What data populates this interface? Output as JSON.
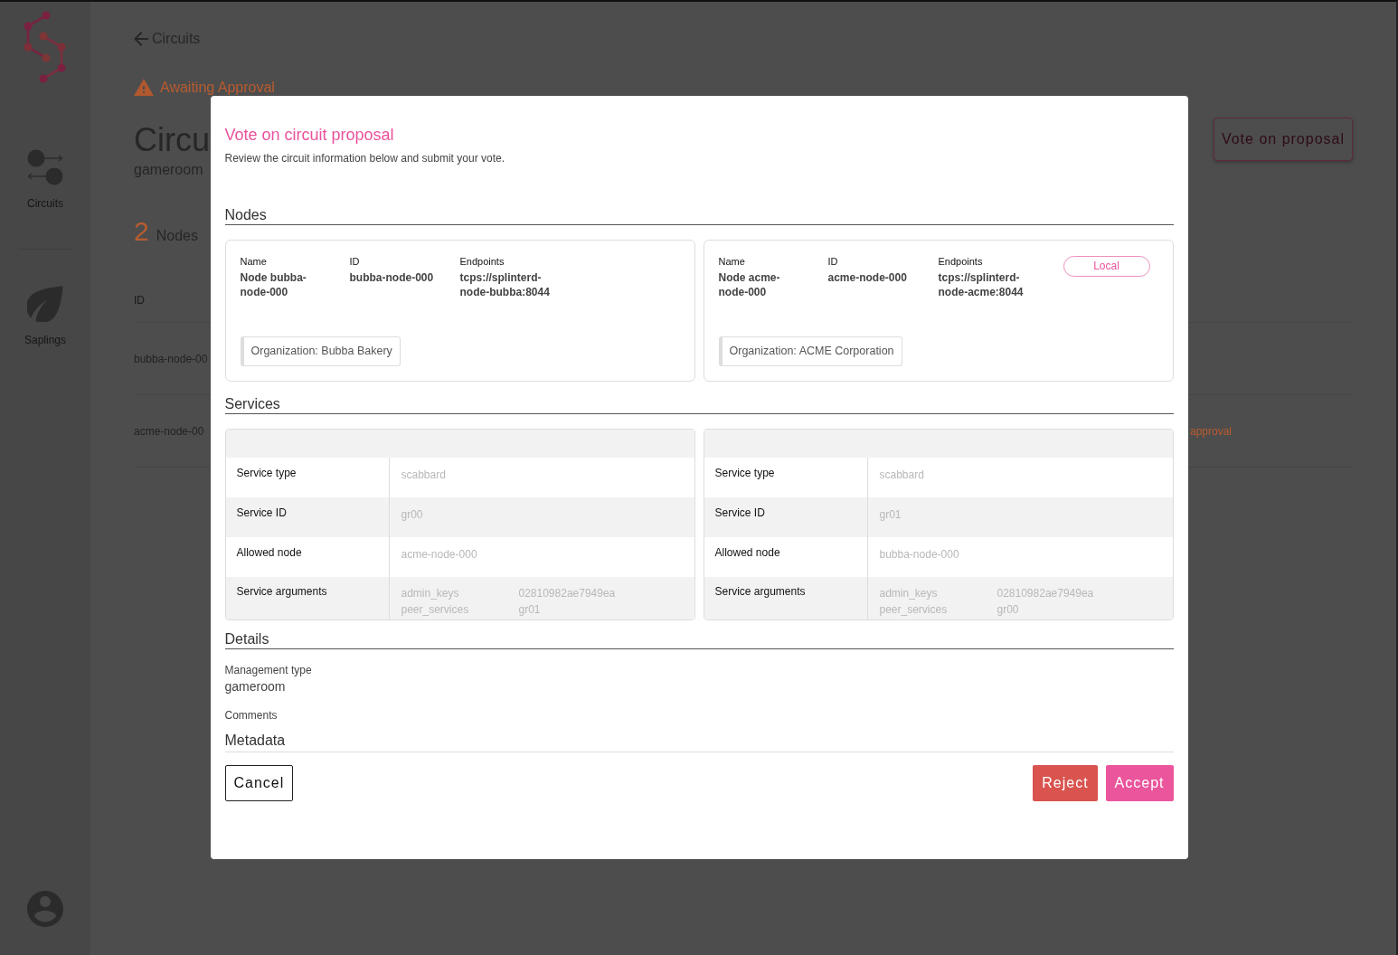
{
  "sidebar": {
    "items": [
      {
        "kind": "circuits",
        "label": "Circuits"
      },
      {
        "kind": "saplings",
        "label": "Saplings"
      }
    ]
  },
  "back_link": "Circuits",
  "status": "Awaiting Approval",
  "title": "Circu",
  "subtitle": "gameroom",
  "vote_button": "Vote on proposal",
  "nodes_summary": {
    "count": "2",
    "label": "Nodes"
  },
  "table": {
    "columns": [
      "ID"
    ],
    "rows": [
      {
        "id": "bubba-node-00"
      },
      {
        "id": "acme-node-00",
        "status": "approval"
      }
    ]
  },
  "modal": {
    "title": "Vote on circuit proposal",
    "subtitle": "Review the circuit information below and submit your vote.",
    "nodes": {
      "heading": "Nodes",
      "cards": [
        {
          "fields": [
            {
              "label": "Name",
              "value": "Node bubba-node-000"
            },
            {
              "label": "ID",
              "value": "bubba-node-000"
            },
            {
              "label": "Endpoints",
              "value": "tcps://splinterd-node-bubba:8044"
            }
          ],
          "organization": "Organization: Bubba Bakery"
        },
        {
          "fields": [
            {
              "label": "Name",
              "value": "Node acme-node-000"
            },
            {
              "label": "ID",
              "value": "acme-node-000"
            },
            {
              "label": "Endpoints",
              "value": "tcps://splinterd-node-acme:8044"
            }
          ],
          "badge": "Local",
          "organization": "Organization: ACME Corporation"
        }
      ]
    },
    "services": {
      "heading": "Services",
      "tables": [
        {
          "rows": [
            {
              "kind": "text",
              "label": "Service type",
              "value": "scabbard"
            },
            {
              "kind": "text",
              "label": "Service ID",
              "value": "gr00"
            },
            {
              "kind": "text",
              "label": "Allowed node",
              "value": "acme-node-000"
            },
            {
              "kind": "arguments",
              "label": "Service arguments",
              "arguments": [
                {
                  "key": "admin_keys",
                  "value": "02810982ae7949ea"
                },
                {
                  "key": "peer_services",
                  "value": "gr01"
                }
              ]
            }
          ]
        },
        {
          "rows": [
            {
              "kind": "text",
              "label": "Service type",
              "value": "scabbard"
            },
            {
              "kind": "text",
              "label": "Service ID",
              "value": "gr01"
            },
            {
              "kind": "text",
              "label": "Allowed node",
              "value": "bubba-node-000"
            },
            {
              "kind": "arguments",
              "label": "Service arguments",
              "arguments": [
                {
                  "key": "admin_keys",
                  "value": "02810982ae7949ea"
                },
                {
                  "key": "peer_services",
                  "value": "gr00"
                }
              ]
            }
          ]
        }
      ]
    },
    "details": {
      "heading": "Details",
      "fields": [
        {
          "label": "Management type",
          "value": "gameroom"
        },
        {
          "label": "Comments"
        }
      ],
      "next_heading": "Metadata"
    },
    "buttons": [
      {
        "kind": "cancel",
        "label": "Cancel"
      },
      {
        "kind": "reject",
        "label": "Reject"
      },
      {
        "kind": "accept",
        "label": "Accept"
      }
    ]
  }
}
